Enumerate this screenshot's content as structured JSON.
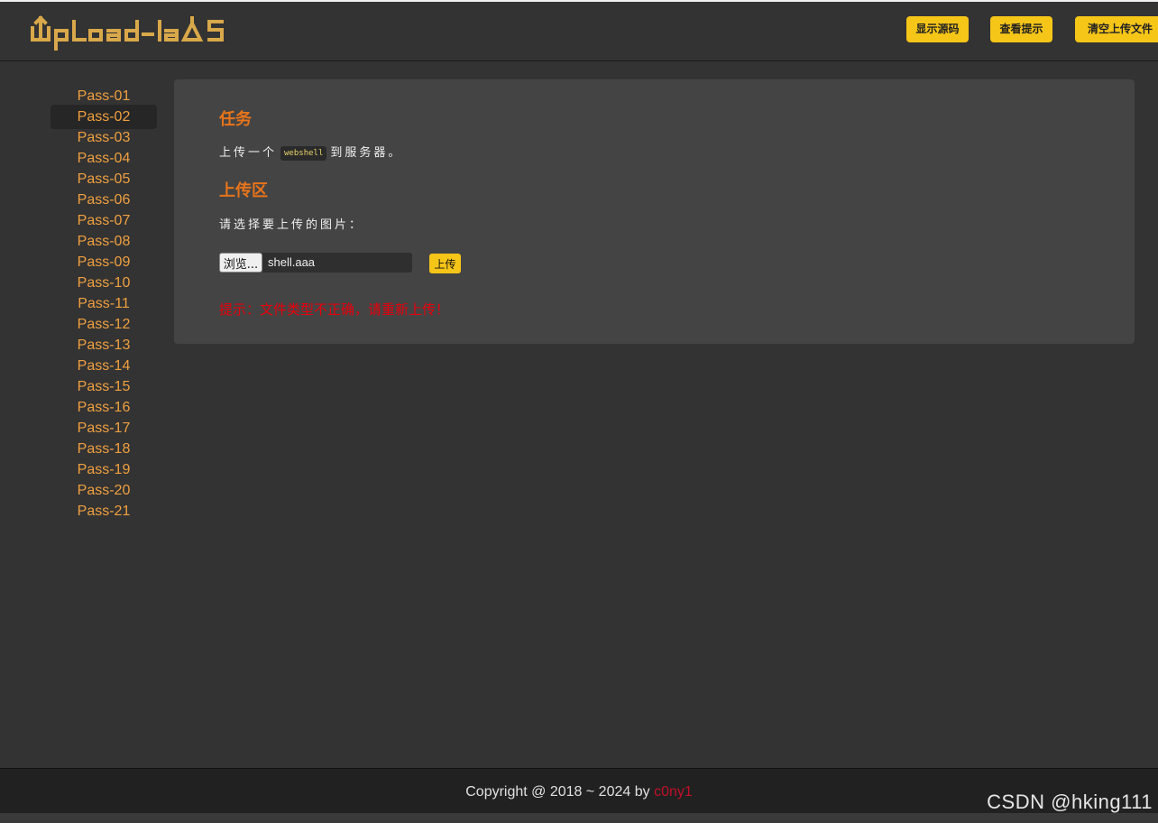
{
  "header": {
    "logo_text": "UpLoad-labS",
    "buttons": {
      "show_source": "显示源码",
      "view_hint": "查看提示",
      "clear_uploads": "清空上传文件"
    }
  },
  "sidebar": {
    "items": [
      "Pass-01",
      "Pass-02",
      "Pass-03",
      "Pass-04",
      "Pass-05",
      "Pass-06",
      "Pass-07",
      "Pass-08",
      "Pass-09",
      "Pass-10",
      "Pass-11",
      "Pass-12",
      "Pass-13",
      "Pass-14",
      "Pass-15",
      "Pass-16",
      "Pass-17",
      "Pass-18",
      "Pass-19",
      "Pass-20",
      "Pass-21"
    ],
    "active": "Pass-02"
  },
  "main": {
    "task_heading": "任务",
    "task_before": "上传一个",
    "task_code": "webshell",
    "task_after": "到服务器。",
    "upload_heading": "上传区",
    "prompt": "请选择要上传的图片：",
    "browse_label": "浏览...",
    "file_name": "shell.aaa",
    "upload_label": "上传",
    "message": "提示：文件类型不正确，请重新上传！"
  },
  "footer": {
    "copyright": "Copyright @ 2018 ~ 2024 by",
    "author": "c0ny1",
    "watermark": "CSDN @hking111"
  },
  "colors": {
    "background": "#333333",
    "accent_yellow": "#f5c518",
    "link_orange": "#f0a040",
    "heading_orange": "#e8741a",
    "error_red": "#e8000b"
  }
}
